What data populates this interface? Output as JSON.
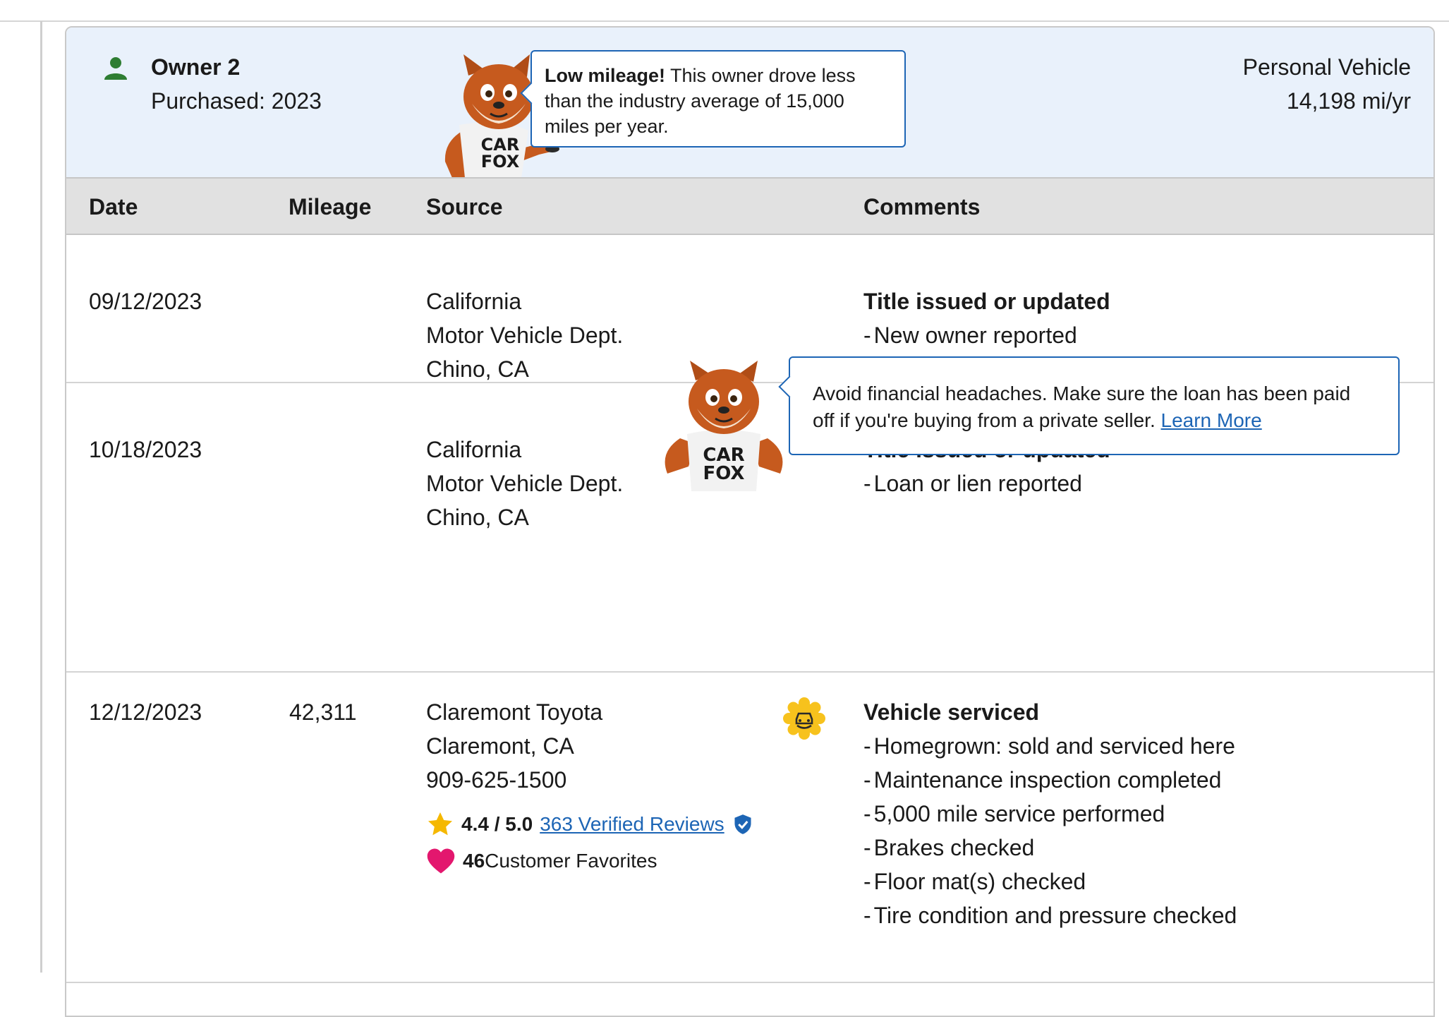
{
  "owner": {
    "title": "Owner 2",
    "purchased": "Purchased: 2023",
    "vehicle_type": "Personal Vehicle",
    "miles_per_year": "14,198 mi/yr",
    "mileage_tip": {
      "bold": "Low mileage!",
      "text": " This owner drove less than the industry average of 15,000 miles per year."
    }
  },
  "mascot": {
    "shirt_line1": "CAR",
    "shirt_line2": "FOX"
  },
  "table": {
    "headers": {
      "date": "Date",
      "mileage": "Mileage",
      "source": "Source",
      "comments": "Comments"
    },
    "rows": [
      {
        "date": "09/12/2023",
        "mileage": "",
        "source": [
          "California",
          "Motor Vehicle Dept.",
          "Chino, CA"
        ],
        "comment_title": "Title issued or updated",
        "comments": [
          "New owner reported"
        ]
      },
      {
        "date": "10/18/2023",
        "mileage": "",
        "source": [
          "California",
          "Motor Vehicle Dept.",
          "Chino, CA"
        ],
        "comment_title": "Title issued or updated",
        "comments": [
          "Loan or lien reported"
        ],
        "tip": {
          "text": "Avoid financial headaches. Make sure the loan has been paid off if you're buying from a private seller. ",
          "link": "Learn More"
        }
      },
      {
        "date": "12/12/2023",
        "mileage": "42,311",
        "source": [
          "Claremont Toyota",
          "Claremont, CA",
          "909-625-1500"
        ],
        "rating": "4.4 / 5.0",
        "reviews_link": "363 Verified Reviews",
        "favorites_count": "46",
        "favorites_label": " Customer Favorites",
        "comment_title": "Vehicle serviced",
        "comments": [
          "Homegrown: sold and serviced here",
          "Maintenance inspection completed",
          "5,000 mile service performed",
          "Brakes checked",
          "Floor mat(s) checked",
          "Tire condition and pressure checked"
        ]
      }
    ]
  },
  "colors": {
    "header_bg": "#e9f1fb",
    "accent_blue": "#1d65b5",
    "person_green": "#2e7d32",
    "star": "#f5b800",
    "heart": "#e3176e",
    "service_badge": "#f7c21d"
  },
  "icons": {
    "owner": "person-icon",
    "service": "car-service-icon",
    "rating": "star-icon",
    "favorites": "heart-icon",
    "verified": "shield-check-icon"
  }
}
